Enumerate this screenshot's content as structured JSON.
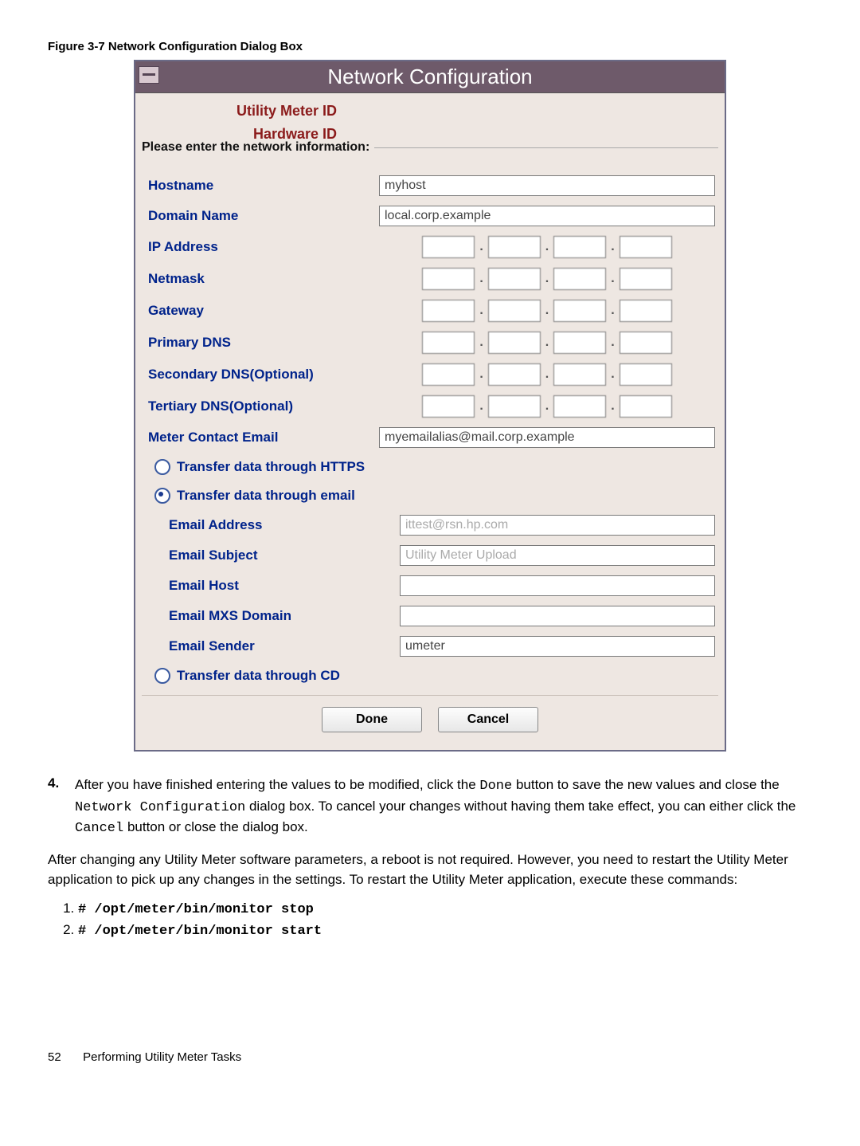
{
  "caption": "Figure 3-7 Network Configuration Dialog Box",
  "dialog": {
    "title": "Network Configuration",
    "utility_meter_id_label": "Utility Meter ID",
    "utility_meter_id_value": "",
    "hardware_id_label": "Hardware ID",
    "hardware_id_value": "",
    "fieldset_label": "Please enter the network information:",
    "hostname_label": "Hostname",
    "hostname_value": "myhost",
    "domain_label": "Domain Name",
    "domain_value": "local.corp.example",
    "ip_label": "IP Address",
    "netmask_label": "Netmask",
    "gateway_label": "Gateway",
    "pdns_label": "Primary DNS",
    "sdns_label": "Secondary DNS(Optional)",
    "tdns_label": "Tertiary DNS(Optional)",
    "contact_label": "Meter Contact Email",
    "contact_value": "myemailalias@mail.corp.example",
    "radio_https": "Transfer data through HTTPS",
    "radio_email": "Transfer data through email",
    "radio_cd": "Transfer data through CD",
    "email_addr_label": "Email Address",
    "email_addr_value": "ittest@rsn.hp.com",
    "email_subj_label": "Email Subject",
    "email_subj_value": "Utility Meter Upload",
    "email_host_label": "Email Host",
    "email_host_value": "",
    "email_mxs_label": "Email MXS Domain",
    "email_mxs_value": "",
    "email_sender_label": "Email Sender",
    "email_sender_value": "umeter",
    "done": "Done",
    "cancel": "Cancel"
  },
  "step4": {
    "num": "4.",
    "text_before": "After you have finished entering the values to be modified, click the ",
    "code1": "Done",
    "text_mid1": " button to save the new values and close the ",
    "code2": "Network Configuration",
    "text_mid2": " dialog box. To cancel your changes without having them take effect, you can either click the ",
    "code3": "Cancel",
    "text_after": " button or close the dialog box."
  },
  "para": "After changing any Utility Meter software parameters, a reboot is not required. However, you need to restart the Utility Meter application to pick up any changes in the settings. To restart the Utility Meter application, execute these commands:",
  "cmds": {
    "c1": "# /opt/meter/bin/monitor stop",
    "c2": "# /opt/meter/bin/monitor start"
  },
  "footer": {
    "page": "52",
    "section": "Performing Utility Meter Tasks"
  }
}
